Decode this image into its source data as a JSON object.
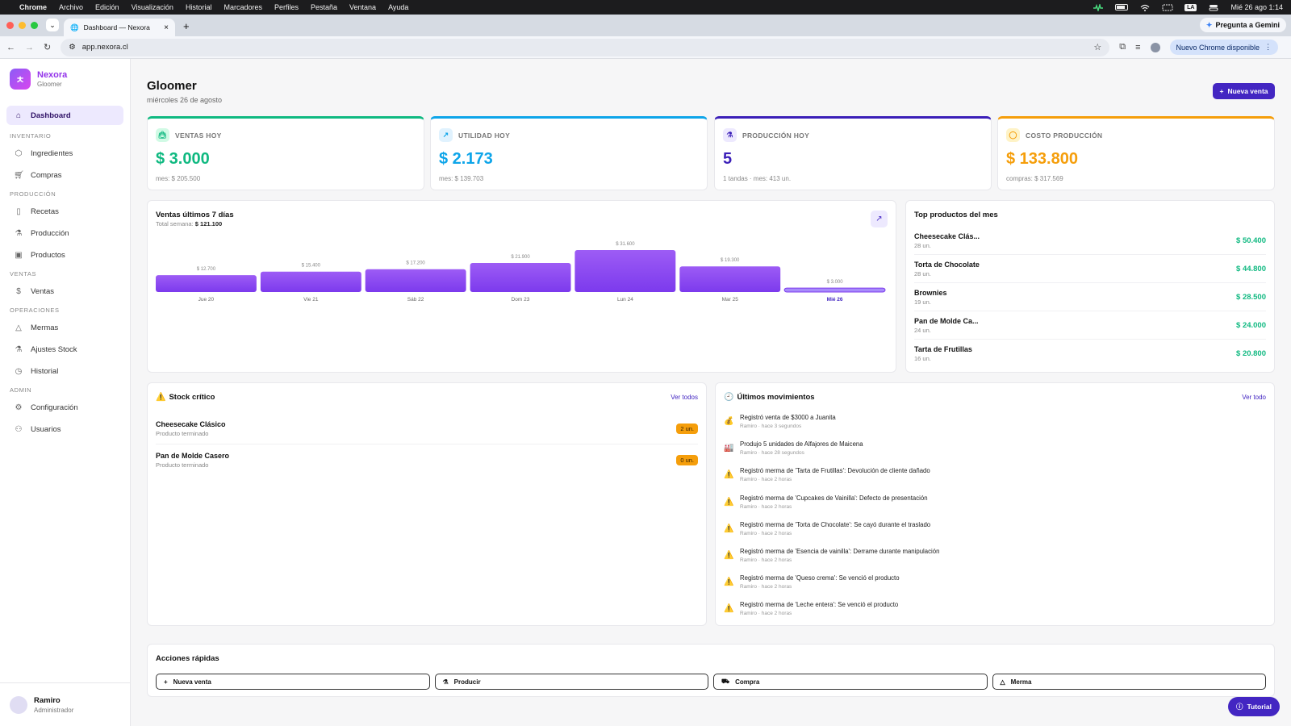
{
  "menubar": {
    "app": "Chrome",
    "items": [
      "Archivo",
      "Edición",
      "Visualización",
      "Historial",
      "Marcadores",
      "Perfiles",
      "Pestaña",
      "Ventana",
      "Ayuda"
    ],
    "input_badge": "LA",
    "clock": "Mié 26 ago 1:14"
  },
  "browser": {
    "tab_title": "Dashboard — Nexora",
    "gemini_label": "Pregunta a Gemini",
    "url": "app.nexora.cl",
    "update_label": "Nuevo Chrome disponible"
  },
  "sidebar": {
    "brand": "Nexora",
    "brand_sub": "Gloomer",
    "dashboard": "Dashboard",
    "sections": [
      {
        "title": "INVENTARIO",
        "items": [
          {
            "label": "Ingredientes",
            "icon": "box-icon"
          },
          {
            "label": "Compras",
            "icon": "cart-icon"
          }
        ]
      },
      {
        "title": "PRODUCCIÓN",
        "items": [
          {
            "label": "Recetas",
            "icon": "book-icon"
          },
          {
            "label": "Producción",
            "icon": "flask-icon"
          },
          {
            "label": "Productos",
            "icon": "archive-icon"
          }
        ]
      },
      {
        "title": "VENTAS",
        "items": [
          {
            "label": "Ventas",
            "icon": "dollar-icon"
          }
        ]
      },
      {
        "title": "OPERACIONES",
        "items": [
          {
            "label": "Mermas",
            "icon": "warning-icon"
          },
          {
            "label": "Ajustes Stock",
            "icon": "flask-icon"
          },
          {
            "label": "Historial",
            "icon": "clock-icon"
          }
        ]
      },
      {
        "title": "ADMIN",
        "items": [
          {
            "label": "Configuración",
            "icon": "gear-icon"
          },
          {
            "label": "Usuarios",
            "icon": "users-icon"
          }
        ]
      }
    ],
    "user": {
      "name": "Ramiro",
      "role": "Administrador"
    }
  },
  "header": {
    "title": "Gloomer",
    "date": "miércoles 26 de agosto",
    "new_sale": "Nueva venta"
  },
  "stats": [
    {
      "label": "VENTAS HOY",
      "value": "$ 3.000",
      "sub": "mes: $ 205.500",
      "color": "#10b981",
      "tint": "#d1fae5",
      "icon": "bag-icon"
    },
    {
      "label": "UTILIDAD HOY",
      "value": "$ 2.173",
      "sub": "mes: $ 139.703",
      "color": "#0ea5e9",
      "tint": "#e0f2fe",
      "icon": "trend-icon"
    },
    {
      "label": "PRODUCCIÓN HOY",
      "value": "5",
      "sub": "1 tandas · mes: 413 un.",
      "color": "#3b1fb8",
      "tint": "#ede9fe",
      "icon": "flask-icon"
    },
    {
      "label": "COSTO PRODUCCIÓN",
      "value": "$ 133.800",
      "sub": "compras: $ 317.569",
      "color": "#f59e0b",
      "tint": "#fef3c7",
      "icon": "coin-icon"
    }
  ],
  "sales_chart": {
    "title": "Ventas últimos 7 días",
    "total_label": "Total semana:",
    "total_value": "$ 121.100"
  },
  "chart_data": {
    "type": "bar",
    "title": "Ventas últimos 7 días",
    "categories": [
      "Jue 20",
      "Vie 21",
      "Sáb 22",
      "Dom 23",
      "Lun 24",
      "Mar 25",
      "Mié 26"
    ],
    "values": [
      12700,
      15400,
      17200,
      21900,
      31600,
      19300,
      3000
    ],
    "value_labels": [
      "$ 12.700",
      "$ 15.400",
      "$ 17.200",
      "$ 21.900",
      "$ 31.600",
      "$ 19.300",
      "$ 3.000"
    ],
    "highlight_index": 6,
    "bar_color": "#7c3aed",
    "highlight_color": "#a78bfa"
  },
  "top_products": {
    "title": "Top productos del mes",
    "items": [
      {
        "name": "Cheesecake Clás...",
        "qty": "28 un.",
        "value": "$ 50.400"
      },
      {
        "name": "Torta de Chocolate",
        "qty": "28 un.",
        "value": "$ 44.800"
      },
      {
        "name": "Brownies",
        "qty": "19 un.",
        "value": "$ 28.500"
      },
      {
        "name": "Pan de Molde Ca...",
        "qty": "24 un.",
        "value": "$ 24.000"
      },
      {
        "name": "Tarta de Frutillas",
        "qty": "16 un.",
        "value": "$ 20.800"
      }
    ]
  },
  "stock": {
    "title": "Stock crítico",
    "link": "Ver todos",
    "items": [
      {
        "name": "Cheesecake Clásico",
        "type": "Producto terminado",
        "badge": "2 un."
      },
      {
        "name": "Pan de Molde Casero",
        "type": "Producto terminado",
        "badge": "0 un."
      }
    ]
  },
  "movements": {
    "title": "Últimos movimientos",
    "link": "Ver todo",
    "items": [
      {
        "icon": "💰",
        "text": "Registró venta de $3000 a Juanita",
        "meta": "Ramiro · hace 3 segundos"
      },
      {
        "icon": "🏭",
        "text": "Produjo 5 unidades de Alfajores de Maicena",
        "meta": "Ramiro · hace 28 segundos"
      },
      {
        "icon": "⚠️",
        "text": "Registró merma de 'Tarta de Frutillas': Devolución de cliente dañado",
        "meta": "Ramiro · hace 2 horas"
      },
      {
        "icon": "⚠️",
        "text": "Registró merma de 'Cupcakes de Vainilla': Defecto de presentación",
        "meta": "Ramiro · hace 2 horas"
      },
      {
        "icon": "⚠️",
        "text": "Registró merma de 'Torta de Chocolate': Se cayó durante el traslado",
        "meta": "Ramiro · hace 2 horas"
      },
      {
        "icon": "⚠️",
        "text": "Registró merma de 'Esencia de vainilla': Derrame durante manipulación",
        "meta": "Ramiro · hace 2 horas"
      },
      {
        "icon": "⚠️",
        "text": "Registró merma de 'Queso crema': Se venció el producto",
        "meta": "Ramiro · hace 2 horas"
      },
      {
        "icon": "⚠️",
        "text": "Registró merma de 'Leche entera': Se venció el producto",
        "meta": "Ramiro · hace 2 horas"
      }
    ]
  },
  "quick_actions": {
    "title": "Acciones rápidas",
    "items": [
      {
        "label": "Nueva venta",
        "icon": "plus-icon"
      },
      {
        "label": "Producir",
        "icon": "flask-icon"
      },
      {
        "label": "Compra",
        "icon": "cart-icon"
      },
      {
        "label": "Merma",
        "icon": "warning-icon"
      }
    ]
  },
  "tutorial_label": "Tutorial"
}
